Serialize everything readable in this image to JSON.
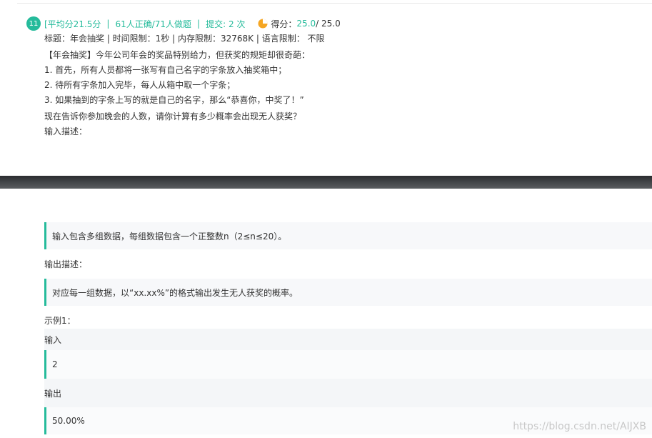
{
  "header": {
    "number": "11",
    "avg": "[平均分21.5分",
    "sep1": "|",
    "correct": "61人正确/71人做题",
    "sep2": "|",
    "submit": "提交: 2 次",
    "score_label": "得分：",
    "score_value": "25.0",
    "score_total": " / 25.0"
  },
  "problem": {
    "meta": "标题：年会抽奖 | 时间限制：1秒 | 内存限制：32768K | 语言限制： 不限",
    "line1": "【年会抽奖】今年公司年会的奖品特别给力，但获奖的规矩却很奇葩：",
    "line2": "1. 首先，所有人员都将一张写有自己名字的字条放入抽奖箱中；",
    "line3": "2. 待所有字条加入完毕，每人从箱中取一个字条；",
    "line4": "3. 如果抽到的字条上写的就是自己的名字，那么“恭喜你，中奖了！”",
    "line5": "现在告诉你参加晚会的人数，请你计算有多少概率会出现无人获奖？",
    "input_label": "输入描述："
  },
  "details": {
    "input_desc": "输入包含多组数据，每组数据包含一个正整数n（2≤n≤20）。",
    "output_label": "输出描述：",
    "output_desc": "对应每一组数据，以“xx.xx%”的格式输出发生无人获奖的概率。",
    "example_label": "示例1：",
    "in_label": "输入",
    "in_value": "2",
    "out_label": "输出",
    "out_value": "50.00%"
  },
  "watermark": "https://blog.csdn.net/AIJXB",
  "colors": {
    "accent": "#25bb9b",
    "pie": "#f5a623"
  }
}
